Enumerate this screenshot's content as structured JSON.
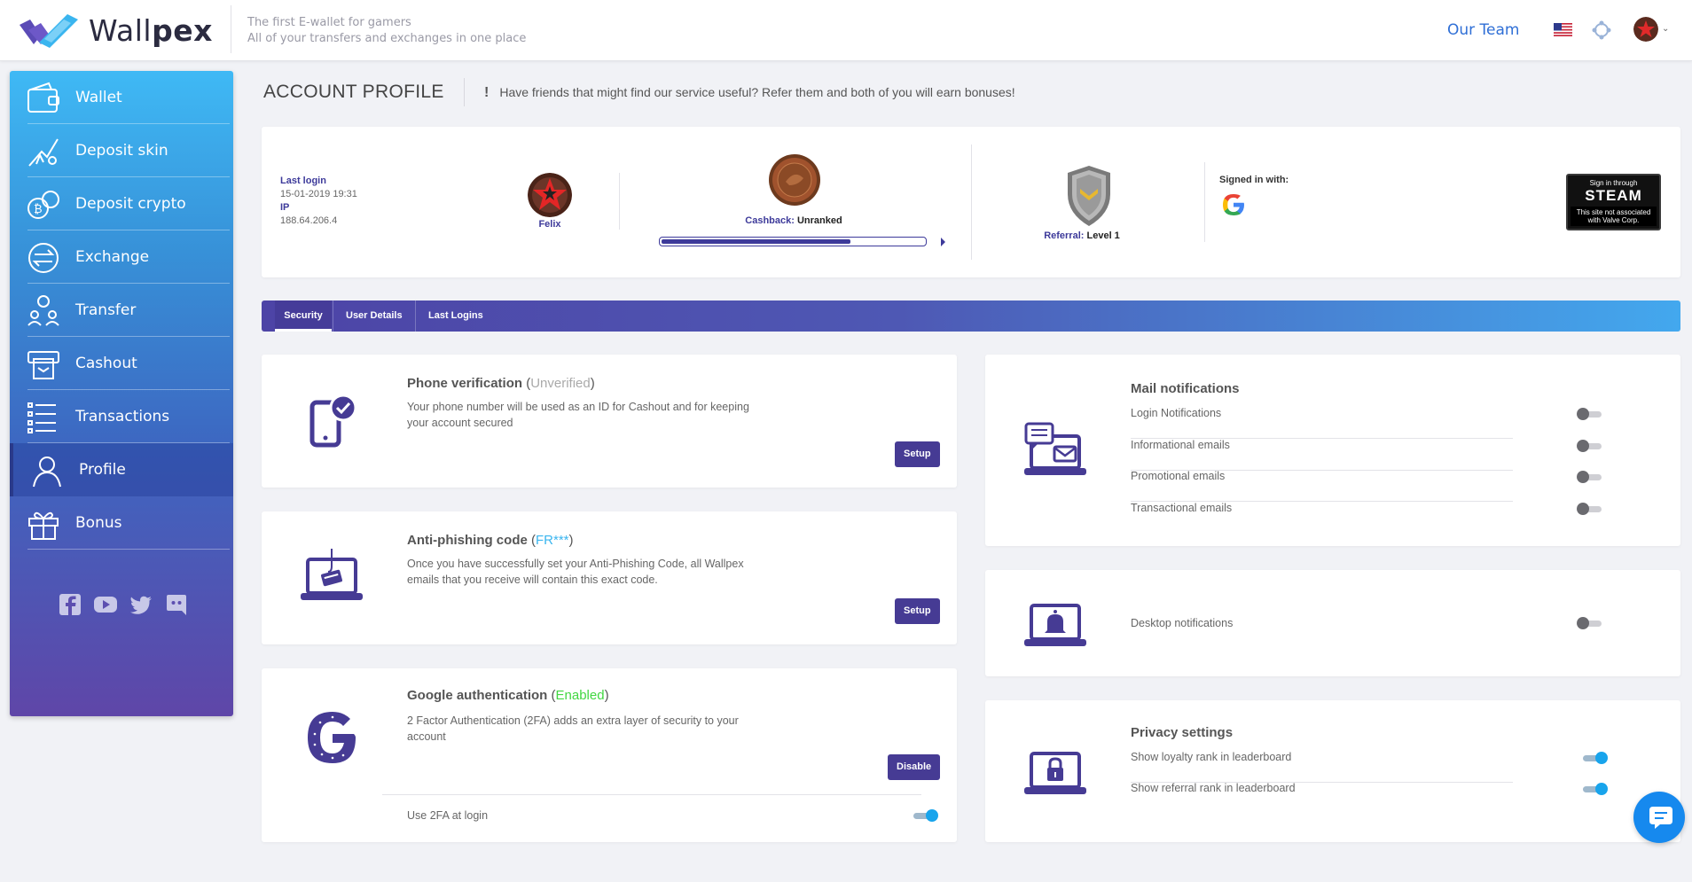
{
  "header": {
    "brand_first": "Wall",
    "brand_bold": "pex",
    "tagline_1": "The first E-wallet for gamers",
    "tagline_2": "All of your transfers and exchanges in one place",
    "our_team": "Our Team",
    "caret": "⌄"
  },
  "sidebar": {
    "items": [
      {
        "label": "Wallet",
        "icon": "wallet-icon"
      },
      {
        "label": "Deposit skin",
        "icon": "deposit-skin-icon"
      },
      {
        "label": "Deposit crypto",
        "icon": "deposit-crypto-icon"
      },
      {
        "label": "Exchange",
        "icon": "exchange-icon"
      },
      {
        "label": "Transfer",
        "icon": "transfer-icon"
      },
      {
        "label": "Cashout",
        "icon": "cashout-icon"
      },
      {
        "label": "Transactions",
        "icon": "transactions-icon"
      },
      {
        "label": "Profile",
        "icon": "profile-icon",
        "active": true
      },
      {
        "label": "Bonus",
        "icon": "bonus-icon"
      }
    ],
    "socials": [
      "facebook-icon",
      "youtube-icon",
      "twitter-icon",
      "discord-icon"
    ]
  },
  "page": {
    "title": "ACCOUNT PROFILE",
    "refer_mark": "!",
    "refer_text": "Have friends that might find our service useful? Refer them and both of you will earn bonuses!"
  },
  "profile": {
    "last_login_label": "Last login",
    "last_login_value": "15-01-2019 19:31",
    "ip_label": "IP",
    "ip_value": "188.64.206.4",
    "username": "Felix",
    "cashback_label": "Cashback:",
    "cashback_value": "Unranked",
    "cashback_progress": 0.72,
    "referral_label": "Referral:",
    "referral_value": "Level 1",
    "signed_in_with": "Signed in with:",
    "steam_line1": "Sign in through",
    "steam_line2": "STEAM",
    "steam_line3a": "This site not associated",
    "steam_line3b": "with Valve Corp."
  },
  "tabs": [
    {
      "label": "Security",
      "active": true
    },
    {
      "label": "User Details"
    },
    {
      "label": "Last Logins"
    }
  ],
  "security": {
    "phone": {
      "title": "Phone verification",
      "open": " (",
      "status": "Unverified",
      "close": ")",
      "desc": "Your phone number will be used as an ID for Cashout and for keeping your account secured",
      "button": "Setup"
    },
    "antiphishing": {
      "title": "Anti-phishing code",
      "open": " (",
      "status": "FR***",
      "close": ")",
      "desc": "Once you have successfully set your Anti-Phishing Code, all Wallpex emails that you receive will contain this exact code.",
      "button": "Setup"
    },
    "google": {
      "title": "Google authentication",
      "open": " (",
      "status": "Enabled",
      "close": ")",
      "desc": "2 Factor Authentication (2FA) adds an extra layer of security to your account",
      "button": "Disable",
      "toggle_label": "Use 2FA at login",
      "toggle_on": true
    }
  },
  "notifications": {
    "mail": {
      "title": "Mail notifications",
      "rows": [
        {
          "label": "Login Notifications",
          "on": false
        },
        {
          "label": "Informational emails",
          "on": false
        },
        {
          "label": "Promotional emails",
          "on": false
        },
        {
          "label": "Transactional emails",
          "on": false
        }
      ]
    },
    "desktop": {
      "label": "Desktop notifications",
      "on": false
    },
    "privacy": {
      "title": "Privacy settings",
      "rows": [
        {
          "label": "Show loyalty rank in leaderboard",
          "on": true
        },
        {
          "label": "Show referral rank in leaderboard",
          "on": true
        }
      ]
    }
  },
  "colors": {
    "brand_purple": "#463b94",
    "accent_blue": "#3ab5ef",
    "enabled_green": "#42d742"
  }
}
